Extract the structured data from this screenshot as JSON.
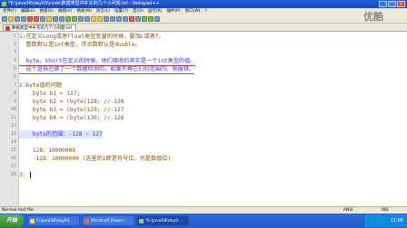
{
  "window": {
    "title": "*E:\\Java58\\day03\\code\\数据类型中补充的几个小问题.txt - Notepad++"
  },
  "menu": [
    "文件(F)",
    "编辑(E)",
    "搜索(S)",
    "视图(V)",
    "格式(M)",
    "语言(L)",
    "设置(T)",
    "宏(O)",
    "运行(R)",
    "插件(P)",
    "窗口(W)",
    "?"
  ],
  "tab": {
    "label": "数据类型中补充的几个小问题.txt"
  },
  "editor": {
    "lines": [
      {
        "n": "1",
        "text": "1:在定义Long或者Float类型变量的时候，要加L或者f。"
      },
      {
        "n": "2",
        "text": "  整数默认是int类型，浮点数默认是double。"
      },
      {
        "n": "3",
        "text": ""
      },
      {
        "n": "4",
        "text": "  byte，short在定义的时候，他们接收的其实是一个int类型的值。"
      },
      {
        "n": "5",
        "text": "  这个是自己做了一个数据检测的，如果不再它们的范围内，就报错。"
      },
      {
        "n": "6",
        "text": ""
      },
      {
        "n": "7",
        "text": "2:byte值的问题"
      },
      {
        "n": "8",
        "text": "    byte b1 = 127;"
      },
      {
        "n": "9",
        "text": "    byte b2 = (byte)128; //-128"
      },
      {
        "n": "10",
        "text": "    byte b3 = (byte)129; //-127"
      },
      {
        "n": "11",
        "text": "    byte b4 = (byte)130; //-126"
      },
      {
        "n": "12",
        "text": ""
      },
      {
        "n": "13",
        "text": "    byte的范围：-128 ~ 127"
      },
      {
        "n": "14",
        "text": ""
      },
      {
        "n": "15",
        "text": "    128：10000000"
      },
      {
        "n": "16",
        "text": "    -128：10000000 (这里的1即是符号位，也是数值位)"
      },
      {
        "n": "17",
        "text": ""
      },
      {
        "n": "18",
        "text": "3:"
      }
    ]
  },
  "status": {
    "type": "Normal text file",
    "encoding": "ANSI",
    "mode": "INS"
  },
  "taskbar": {
    "start": "开始",
    "tasks": [
      "E:\\Java58\\day03",
      "Microsoft Power...",
      "*E:\\Java58\\day0..."
    ],
    "clock": "11:06"
  },
  "watermark": "优酷"
}
